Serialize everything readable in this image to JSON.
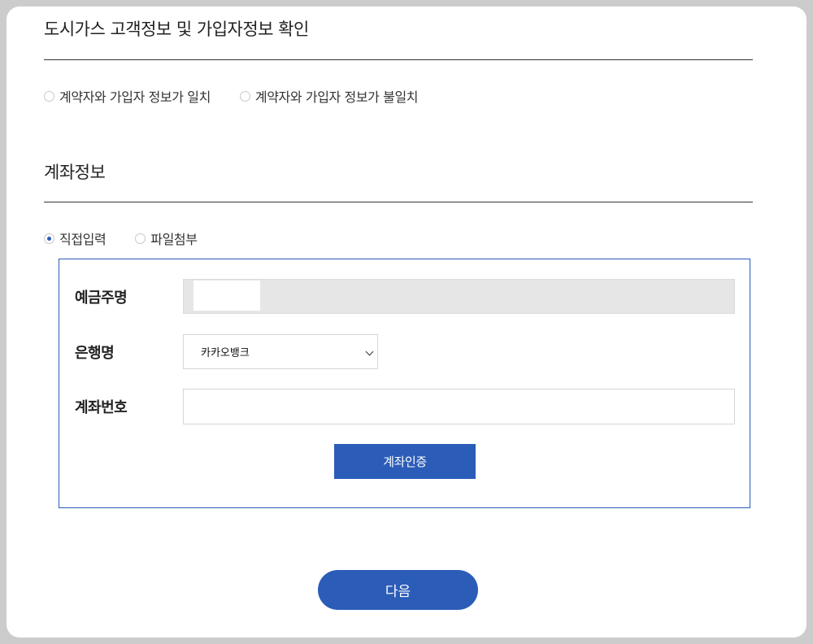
{
  "customer_section": {
    "title": "도시가스 고객정보 및 가입자정보 확인",
    "options": [
      {
        "label": "계약자와 가입자 정보가 일치",
        "checked": false
      },
      {
        "label": "계약자와 가입자 정보가 불일치",
        "checked": false
      }
    ]
  },
  "account_section": {
    "title": "계좌정보",
    "input_modes": [
      {
        "label": "직접입력",
        "checked": true
      },
      {
        "label": "파일첨부",
        "checked": false
      }
    ],
    "depositor_label": "예금주명",
    "bank_label": "은행명",
    "bank_selected": "카카오뱅크",
    "account_label": "계좌번호",
    "account_value": "",
    "verify_label": "계좌인증"
  },
  "next_label": "다음",
  "colors": {
    "accent": "#2b5cb8",
    "frame_border": "#cccccc",
    "readonly_bg": "#e6e6e6"
  }
}
